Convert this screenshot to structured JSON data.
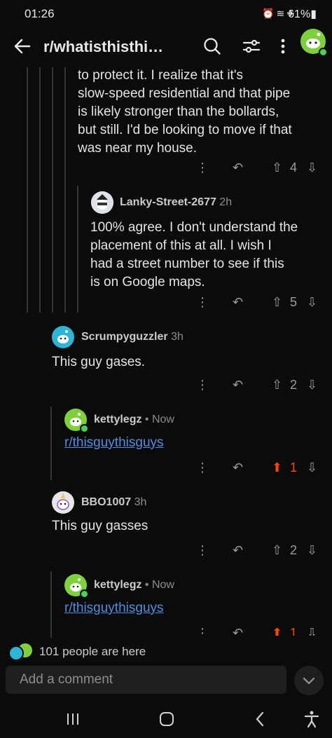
{
  "status_bar": {
    "time": "01:26",
    "battery": "61%"
  },
  "header": {
    "title": "r/whatisthisthi…"
  },
  "comments": [
    {
      "id": "c1",
      "text_lines": [
        "to protect it. I realize that it's",
        "slow-speed residential and that pipe",
        "is likely stronger than the bollards,",
        "but still. I'd be looking to move if that",
        "was near my house."
      ],
      "votes": "4"
    },
    {
      "id": "c2",
      "user": "Lanky-Street-2677",
      "time": "2h",
      "text_lines": [
        "100% agree. I don't understand the",
        "placement of this at all. I wish I",
        "had a street number to see if this",
        "is on Google maps."
      ],
      "votes": "5"
    },
    {
      "id": "c3",
      "user": "Scrumpyguzzler",
      "time": "3h",
      "text": "This guy gases.",
      "votes": "2"
    },
    {
      "id": "c4",
      "user": "kettylegz",
      "time": "• Now",
      "link": "r/thisguythisguys",
      "votes": "1"
    },
    {
      "id": "c5",
      "user": "BBO1007",
      "time": "3h",
      "text": "This guy gasses",
      "votes": "2"
    },
    {
      "id": "c6",
      "user": "kettylegz",
      "time": "• Now",
      "link": "r/thisguythisguys",
      "votes": "1"
    }
  ],
  "presence": {
    "text": "101 people are here"
  },
  "composer": {
    "placeholder": "Add a comment"
  },
  "colors": {
    "upvoted": "#ff4500",
    "link": "#4f8fe0",
    "online": "#46d160"
  },
  "icons": {
    "back": "arrow-left",
    "search": "search",
    "filter": "sliders",
    "more": "vertical-dots",
    "reply": "reply-arrow",
    "upvote": "up-arrow",
    "downvote": "down-arrow"
  }
}
